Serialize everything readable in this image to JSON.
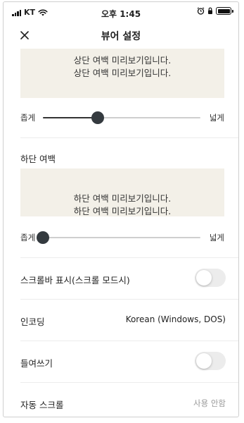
{
  "status_bar": {
    "carrier": "KT",
    "time": "오후 1:45"
  },
  "header": {
    "title": "뷰어 설정"
  },
  "top_margin": {
    "preview_lines": [
      "상단 여백 미리보기입니다.",
      "상단 여백 미리보기입니다."
    ],
    "slider": {
      "min_label": "좁게",
      "max_label": "넓게",
      "value_fraction": 0.35
    }
  },
  "bottom_margin": {
    "label": "하단 여백",
    "preview_lines": [
      "하단 여백 미리보기입니다.",
      "하단 여백 미리보기입니다."
    ],
    "slider": {
      "min_label": "좁게",
      "max_label": "넓게",
      "value_fraction": 0.0
    }
  },
  "settings": {
    "scrollbar": {
      "label": "스크롤바 표시(스크롤 모드시)",
      "enabled": false
    },
    "encoding": {
      "label": "인코딩",
      "value": "Korean (Windows, DOS)"
    },
    "indent": {
      "label": "들여쓰기",
      "enabled": false
    },
    "autoscroll": {
      "label": "자동 스크롤",
      "value": "사용 안함"
    }
  },
  "colors": {
    "preview_bg": "#f3f0e8",
    "slider_thumb": "#343a3f",
    "toggle_off": "#ececec"
  }
}
